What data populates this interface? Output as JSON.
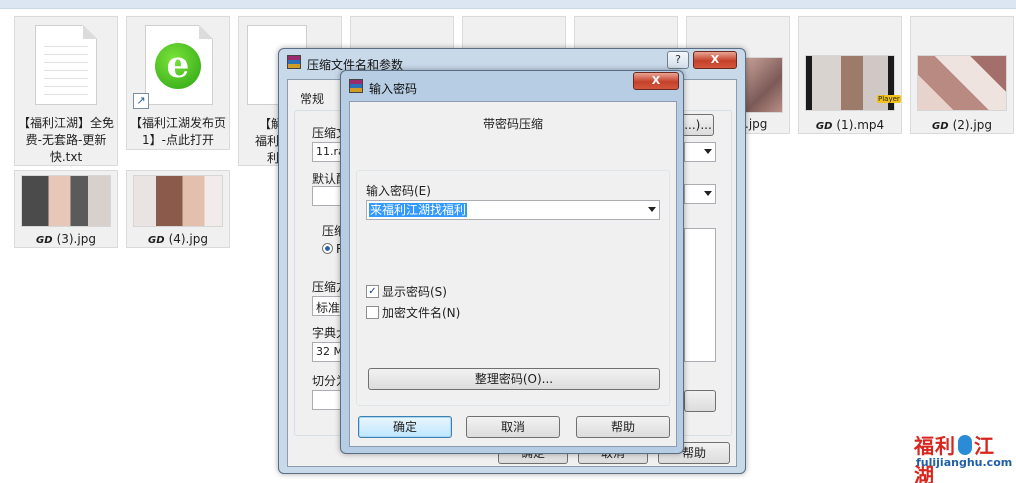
{
  "explorer": {
    "files": [
      {
        "name": "【福利江湖】全免费-无套路-更新快.txt",
        "type": "txt"
      },
      {
        "name": "【福利江湖发布页1】-点此打开",
        "type": "shortcut"
      },
      {
        "name_prefix": "【解压",
        "name_line2": "福利",
        "name_line3": "利",
        "type": "partial"
      },
      {
        "name": ".jpg",
        "type": "image"
      },
      {
        "name": "(1).mp4",
        "type": "video",
        "badge": "Player"
      },
      {
        "name": "(2).jpg",
        "type": "image"
      },
      {
        "name": "(3).jpg",
        "type": "image"
      },
      {
        "name": "(4).jpg",
        "type": "image"
      }
    ],
    "gd_prefix": "GD"
  },
  "archive_dialog": {
    "title": "压缩文件名和参数",
    "help_glyph": "?",
    "close_glyph": "X",
    "tab_general": "常规",
    "label_archive": "压缩文",
    "archive_value": "11.ra",
    "label_default": "默认配",
    "label_format_group": "压缩",
    "radio_value": "R",
    "label_method": "压缩方",
    "method_value": "标准",
    "label_dict": "字典大",
    "dict_value": "32 M",
    "label_split": "切分为",
    "browse_label": "...)...",
    "help_button": "帮助",
    "ok_button": "确定",
    "cancel_button": "取消"
  },
  "password_dialog": {
    "title": "输入密码",
    "close_glyph": "X",
    "heading": "带密码压缩",
    "label_password": "输入密码(E)",
    "password_value": "来福利江湖找福利",
    "show_password": "显示密码(S)",
    "show_password_checked": true,
    "encrypt_names": "加密文件名(N)",
    "encrypt_names_checked": false,
    "organize_button": "整理密码(O)...",
    "ok_button": "确定",
    "cancel_button": "取消",
    "help_button": "帮助"
  },
  "watermark": {
    "brand_left": "福利",
    "brand_right": "江湖",
    "url": "fulijianghu.com"
  }
}
